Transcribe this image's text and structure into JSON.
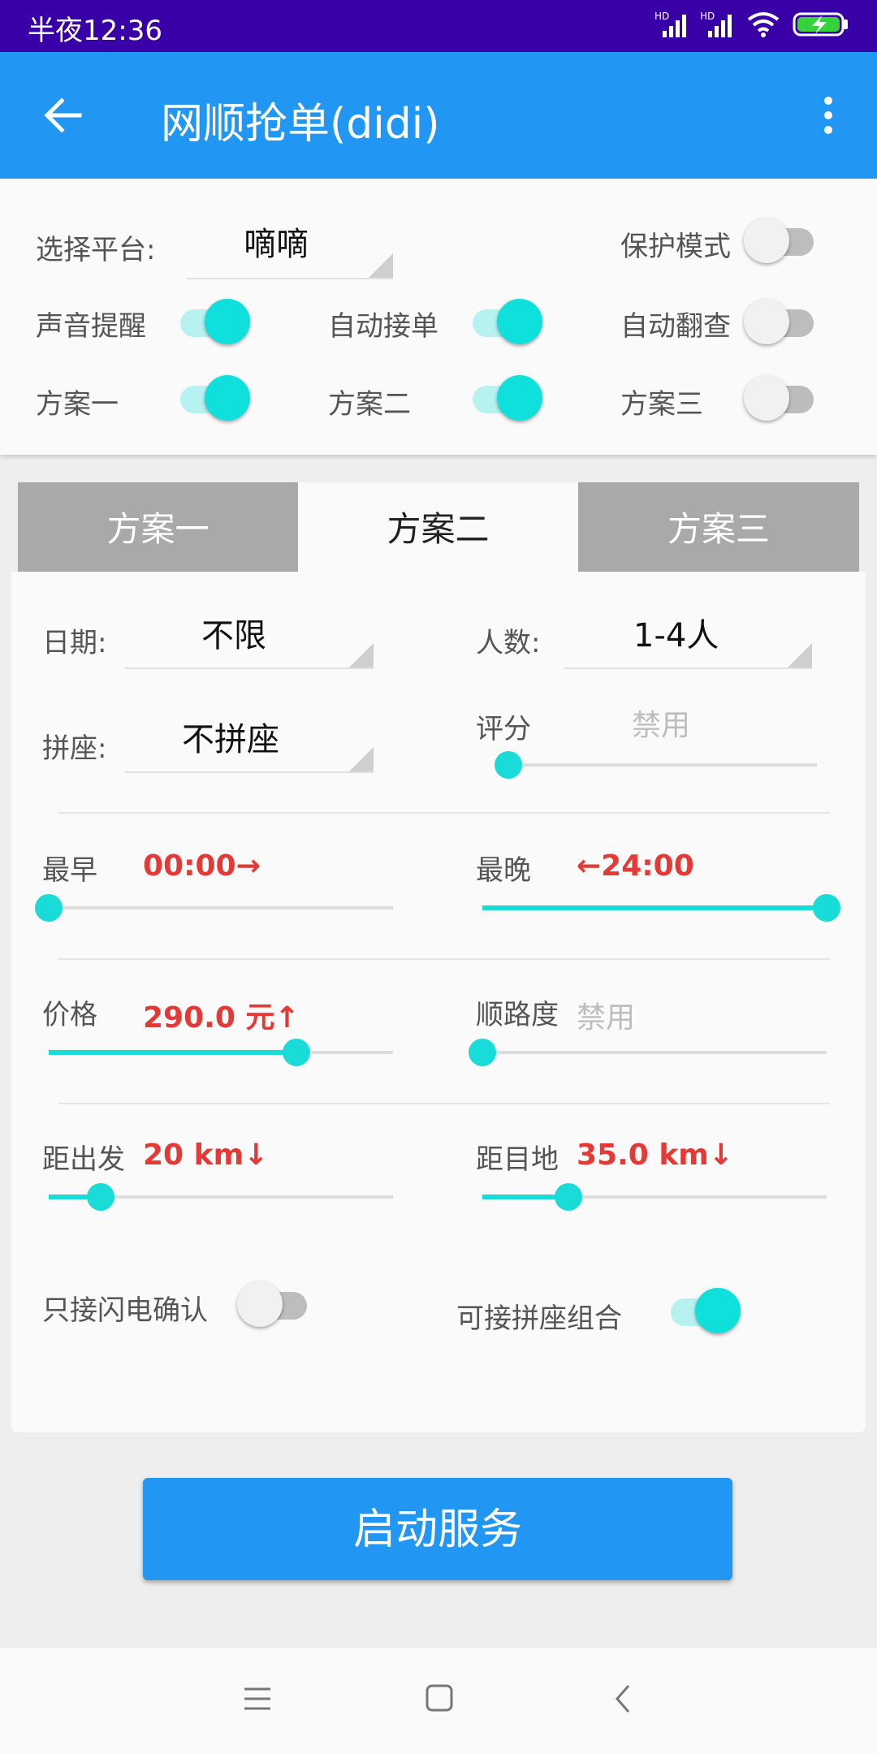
{
  "status_bar": {
    "time": "半夜12:36",
    "net1": "HD",
    "net2": "HD"
  },
  "app_bar": {
    "title": "网顺抢单(didi)"
  },
  "top": {
    "platform_label": "选择平台:",
    "platform_value": "嘀嘀",
    "protect_mode": {
      "label": "保护模式",
      "on": false
    },
    "sound_alert": {
      "label": "声音提醒",
      "on": true
    },
    "auto_accept": {
      "label": "自动接单",
      "on": true
    },
    "auto_flip": {
      "label": "自动翻查",
      "on": false
    },
    "plan1": {
      "label": "方案一",
      "on": true
    },
    "plan2": {
      "label": "方案二",
      "on": true
    },
    "plan3": {
      "label": "方案三",
      "on": false
    }
  },
  "tabs": [
    {
      "label": "方案一",
      "active": false
    },
    {
      "label": "方案二",
      "active": true
    },
    {
      "label": "方案三",
      "active": false
    }
  ],
  "form": {
    "date_label": "日期:",
    "date_value": "不限",
    "people_label": "人数:",
    "people_value": "1-4人",
    "carpool_label": "拼座:",
    "carpool_value": "不拼座",
    "rating_label": "评分",
    "rating_value": "禁用",
    "rating_level": 0,
    "earliest_label": "最早",
    "earliest_value": "00:00→",
    "earliest_level": 0,
    "latest_label": "最晚",
    "latest_value": "←24:00",
    "latest_level": 1,
    "price_label": "价格",
    "price_value": "290.0 元↑",
    "price_level": 0.72,
    "route_label": "顺路度",
    "route_value": "禁用",
    "route_level": 0,
    "dist_start_label": "距出发",
    "dist_start_value": "20 km↓",
    "dist_start_level": 0.15,
    "dist_dest_label": "距目地",
    "dist_dest_value": "35.0 km↓",
    "dist_dest_level": 0.25,
    "flash_confirm": {
      "label": "只接闪电确认",
      "on": false
    },
    "carpool_combo": {
      "label": "可接拼座组合",
      "on": true
    }
  },
  "start_button": "启动服务",
  "colors": {
    "primary": "#2196f3",
    "accent": "#19dcd8",
    "status_bar": "#3a00a8",
    "value_red": "#e53935"
  }
}
